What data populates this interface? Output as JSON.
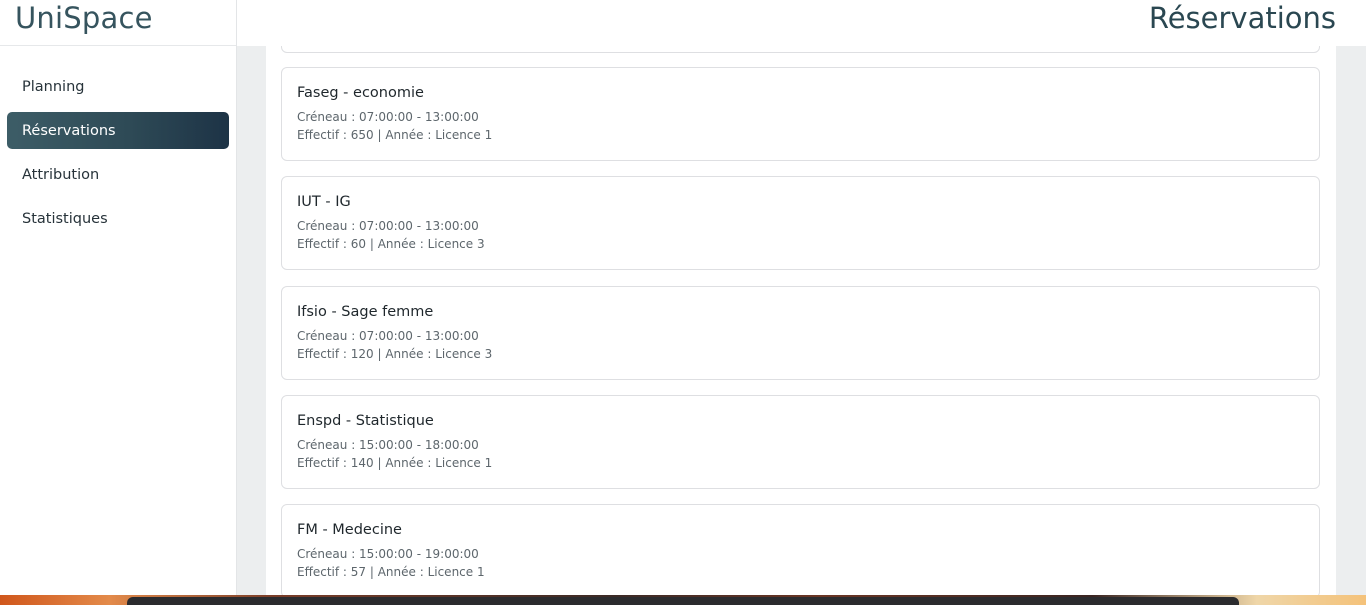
{
  "app": {
    "name": "UniSpace"
  },
  "header": {
    "title": "Réservations"
  },
  "sidebar": {
    "items": [
      {
        "label": "Planning",
        "active": false
      },
      {
        "label": "Réservations",
        "active": true
      },
      {
        "label": "Attribution",
        "active": false
      },
      {
        "label": "Statistiques",
        "active": false
      }
    ]
  },
  "reservations": [
    {
      "title": "Faseg - economie",
      "creneau": "Créneau : 07:00:00 - 13:00:00",
      "details": "Effectif : 650 | Année : Licence 1"
    },
    {
      "title": "IUT - IG",
      "creneau": "Créneau : 07:00:00 - 13:00:00",
      "details": "Effectif : 60 | Année : Licence 3"
    },
    {
      "title": "Ifsio - Sage femme",
      "creneau": "Créneau : 07:00:00 - 13:00:00",
      "details": "Effectif : 120 | Année : Licence 3"
    },
    {
      "title": "Enspd - Statistique",
      "creneau": "Créneau : 15:00:00 - 18:00:00",
      "details": "Effectif : 140 | Année : Licence 1"
    },
    {
      "title": "FM - Medecine",
      "creneau": "Créneau : 15:00:00 - 19:00:00",
      "details": "Effectif : 57 | Année : Licence 1"
    }
  ],
  "colors": {
    "brand": "#36545e",
    "active_nav_start": "#3d5d67",
    "active_nav_end": "#1d3346"
  }
}
